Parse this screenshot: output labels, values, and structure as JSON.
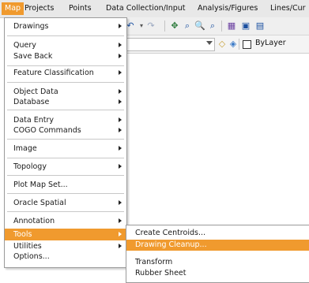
{
  "menubar": {
    "items": [
      "Map",
      "Projects",
      "Points",
      "Data Collection/Input",
      "Analysis/Figures",
      "Lines/Cur"
    ]
  },
  "toolbar": {
    "linetype_value": "ByLayer"
  },
  "main_menu": {
    "items": [
      {
        "label": "Drawings",
        "submenu": true
      },
      {
        "label": "Query",
        "submenu": true
      },
      {
        "label": "Save Back",
        "submenu": true
      },
      {
        "label": "Feature Classification",
        "submenu": true
      },
      {
        "label": "Object Data",
        "submenu": true
      },
      {
        "label": "Database",
        "submenu": true
      },
      {
        "label": "Data Entry",
        "submenu": true
      },
      {
        "label": "COGO Commands",
        "submenu": true
      },
      {
        "label": "Image",
        "submenu": true
      },
      {
        "label": "Topology",
        "submenu": true
      },
      {
        "label": "Plot Map Set...",
        "submenu": false
      },
      {
        "label": "Oracle Spatial",
        "submenu": true
      },
      {
        "label": "Annotation",
        "submenu": true
      },
      {
        "label": "Tools",
        "submenu": true
      },
      {
        "label": "Utilities",
        "submenu": true
      },
      {
        "label": "Options...",
        "submenu": false
      }
    ]
  },
  "tools_submenu": {
    "items": [
      {
        "label": "Create Centroids..."
      },
      {
        "label": "Drawing Cleanup..."
      },
      {
        "label": "Transform"
      },
      {
        "label": "Rubber Sheet"
      }
    ]
  },
  "colors": {
    "highlight": "#f09a2e",
    "menu_border": "#9a9a9a"
  }
}
